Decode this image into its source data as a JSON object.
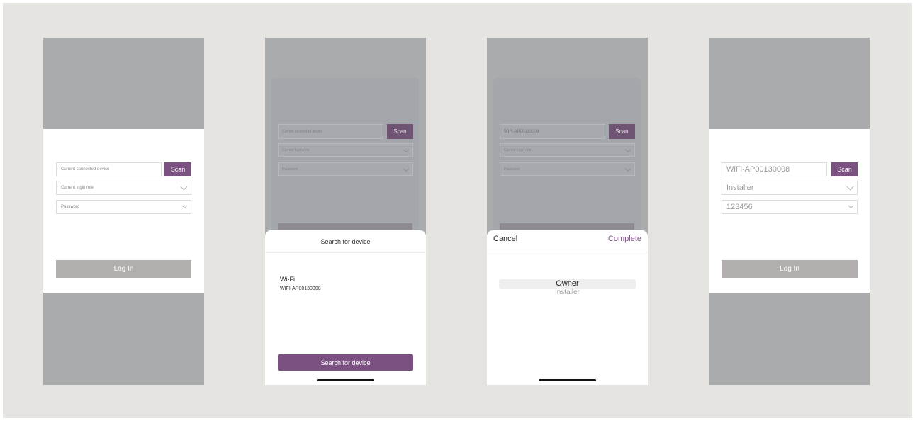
{
  "screen1": {
    "device_placeholder": "Current connected device",
    "scan_label": "Scan",
    "role_placeholder": "Current login role",
    "password_placeholder": "Password",
    "login_label": "Log In"
  },
  "screen2": {
    "device_placeholder": "Current connected device",
    "scan_label": "Scan",
    "role_placeholder": "Current login role",
    "password_placeholder": "Password",
    "sheet_title": "Search for device",
    "wifi_heading": "Wi-Fi",
    "wifi_device": "WIFI-AP00130008",
    "search_button": "Search for device"
  },
  "screen3": {
    "device_value": "WIFI-AP00130008",
    "scan_label": "Scan",
    "role_placeholder": "Current login role",
    "password_placeholder": "Password",
    "cancel_label": "Cancel",
    "complete_label": "Complete",
    "options": [
      "Owner",
      "Installer"
    ]
  },
  "screen4": {
    "device_value": "WiFi-AP00130008",
    "scan_label": "Scan",
    "role_value": "Installer",
    "password_value": "123456",
    "login_label": "Log In"
  },
  "colors": {
    "background": "#e6e4e1",
    "gray_band": "#a9abad",
    "accent_purple": "#7a5180",
    "login_button": "#b3aeae"
  }
}
